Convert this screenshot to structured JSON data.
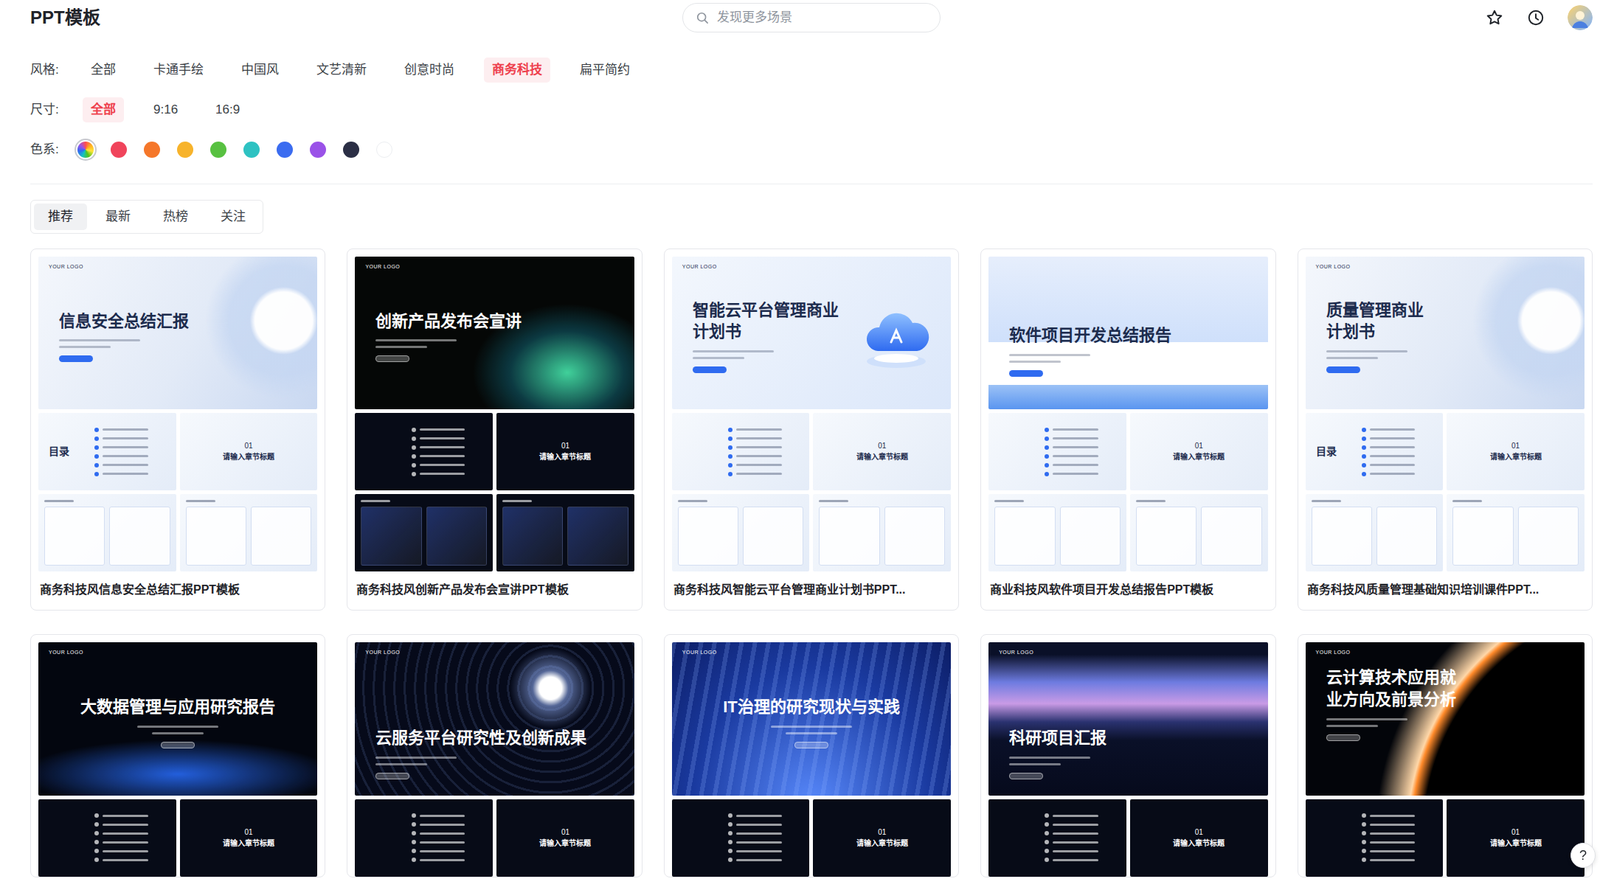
{
  "header": {
    "title": "PPT模板",
    "search": {
      "placeholder": "发现更多场景"
    }
  },
  "filters": [
    {
      "label": "风格:",
      "options": [
        {
          "label": "全部",
          "selected": false
        },
        {
          "label": "卡通手绘",
          "selected": false
        },
        {
          "label": "中国风",
          "selected": false
        },
        {
          "label": "文艺清新",
          "selected": false
        },
        {
          "label": "创意时尚",
          "selected": false
        },
        {
          "label": "商务科技",
          "selected": true
        },
        {
          "label": "扁平简约",
          "selected": false
        }
      ]
    },
    {
      "label": "尺寸:",
      "options": [
        {
          "label": "全部",
          "selected": true
        },
        {
          "label": "9:16",
          "selected": false
        },
        {
          "label": "16:9",
          "selected": false
        }
      ]
    }
  ],
  "colors": {
    "label": "色系:",
    "swatches": [
      {
        "kind": "spectrum",
        "selected": true
      },
      {
        "kind": "solid",
        "color": "#f0445b",
        "selected": false
      },
      {
        "kind": "solid",
        "color": "#f5772a",
        "selected": false
      },
      {
        "kind": "solid",
        "color": "#f7b32b",
        "selected": false
      },
      {
        "kind": "solid",
        "color": "#58c141",
        "selected": false
      },
      {
        "kind": "solid",
        "color": "#2ec2c2",
        "selected": false
      },
      {
        "kind": "solid",
        "color": "#3b6cf0",
        "selected": false
      },
      {
        "kind": "solid",
        "color": "#9a52e8",
        "selected": false
      },
      {
        "kind": "solid",
        "color": "#2b2f45",
        "selected": false
      },
      {
        "kind": "solid",
        "color": "#ffffff",
        "selected": false
      }
    ]
  },
  "tabs": [
    {
      "label": "推荐",
      "selected": true
    },
    {
      "label": "最新",
      "selected": false
    },
    {
      "label": "热榜",
      "selected": false
    },
    {
      "label": "关注",
      "selected": false
    }
  ],
  "templates": [
    {
      "caption": "商务科技风信息安全总结汇报PPT模板",
      "tone": "light",
      "slide": {
        "kind": "glass",
        "logo": "YOUR LOGO",
        "title": "信息安全总结汇报"
      },
      "minis": [
        {
          "kind": "toc",
          "label": "目录"
        },
        {
          "kind": "section",
          "number": "01",
          "label": "请输入章节标题"
        },
        {
          "kind": "content"
        },
        {
          "kind": "content"
        }
      ]
    },
    {
      "caption": "商务科技风创新产品发布会宣讲PPT模板",
      "tone": "dark",
      "slide": {
        "kind": "aurora",
        "logo": "YOUR LOGO",
        "title": "创新产品发布会宣讲"
      },
      "minis": [
        {
          "kind": "toc"
        },
        {
          "kind": "section",
          "number": "01",
          "label": "请输入章节标题"
        },
        {
          "kind": "content"
        },
        {
          "kind": "content"
        }
      ]
    },
    {
      "caption": "商务科技风智能云平台管理商业计划书PPT...",
      "tone": "light",
      "slide": {
        "kind": "cloud",
        "logo": "YOUR LOGO",
        "title": "智能云平台管理商业\n计划书"
      },
      "minis": [
        {
          "kind": "toc"
        },
        {
          "kind": "section",
          "number": "01",
          "label": "请输入章节标题"
        },
        {
          "kind": "content"
        },
        {
          "kind": "content"
        }
      ]
    },
    {
      "caption": "商业科技风软件项目开发总结报告PPT模板",
      "tone": "light",
      "slide": {
        "kind": "band",
        "title": "软件项目开发总结报告"
      },
      "minis": [
        {
          "kind": "toc"
        },
        {
          "kind": "section",
          "number": "01",
          "label": "请输入章节标题"
        },
        {
          "kind": "content"
        },
        {
          "kind": "content"
        }
      ]
    },
    {
      "caption": "商务科技风质量管理基础知识培训课件PPT...",
      "tone": "light",
      "slide": {
        "kind": "glass",
        "logo": "YOUR LOGO",
        "title": "质量管理商业\n计划书"
      },
      "minis": [
        {
          "kind": "toc",
          "label": "目录"
        },
        {
          "kind": "section",
          "number": "01",
          "label": "请输入章节标题"
        },
        {
          "kind": "content"
        },
        {
          "kind": "content"
        }
      ]
    },
    {
      "tone": "dark",
      "slide": {
        "kind": "wave",
        "logo": "YOUR LOGO",
        "title": "大数据管理与应用研究报告"
      },
      "minis": [
        {
          "kind": "toc"
        },
        {
          "kind": "section",
          "number": "01",
          "label": "请输入章节标题"
        }
      ]
    },
    {
      "tone": "dark",
      "slide": {
        "kind": "galaxy",
        "logo": "YOUR LOGO",
        "title": "云服务平台研究性及创新成果"
      },
      "minis": [
        {
          "kind": "toc"
        },
        {
          "kind": "section",
          "number": "01",
          "label": "请输入章节标题"
        }
      ]
    },
    {
      "tone": "dark",
      "slide": {
        "kind": "beam",
        "logo": "YOUR LOGO",
        "title": "IT治理的研究现状与实践"
      },
      "minis": [
        {
          "kind": "toc"
        },
        {
          "kind": "section",
          "number": "01",
          "label": "请输入章节标题"
        }
      ]
    },
    {
      "tone": "dark",
      "slide": {
        "kind": "mountain",
        "logo": "YOUR LOGO",
        "title": "科研项目汇报"
      },
      "minis": [
        {
          "kind": "toc"
        },
        {
          "kind": "section",
          "number": "01",
          "label": "请输入章节标题"
        }
      ]
    },
    {
      "tone": "dark",
      "slide": {
        "kind": "eclipse",
        "logo": "YOUR LOGO",
        "title": "云计算技术应用就\n业方向及前景分析"
      },
      "minis": [
        {
          "kind": "toc"
        },
        {
          "kind": "section",
          "number": "01",
          "label": "请输入章节标题"
        }
      ]
    }
  ],
  "help": {
    "label": "?"
  }
}
